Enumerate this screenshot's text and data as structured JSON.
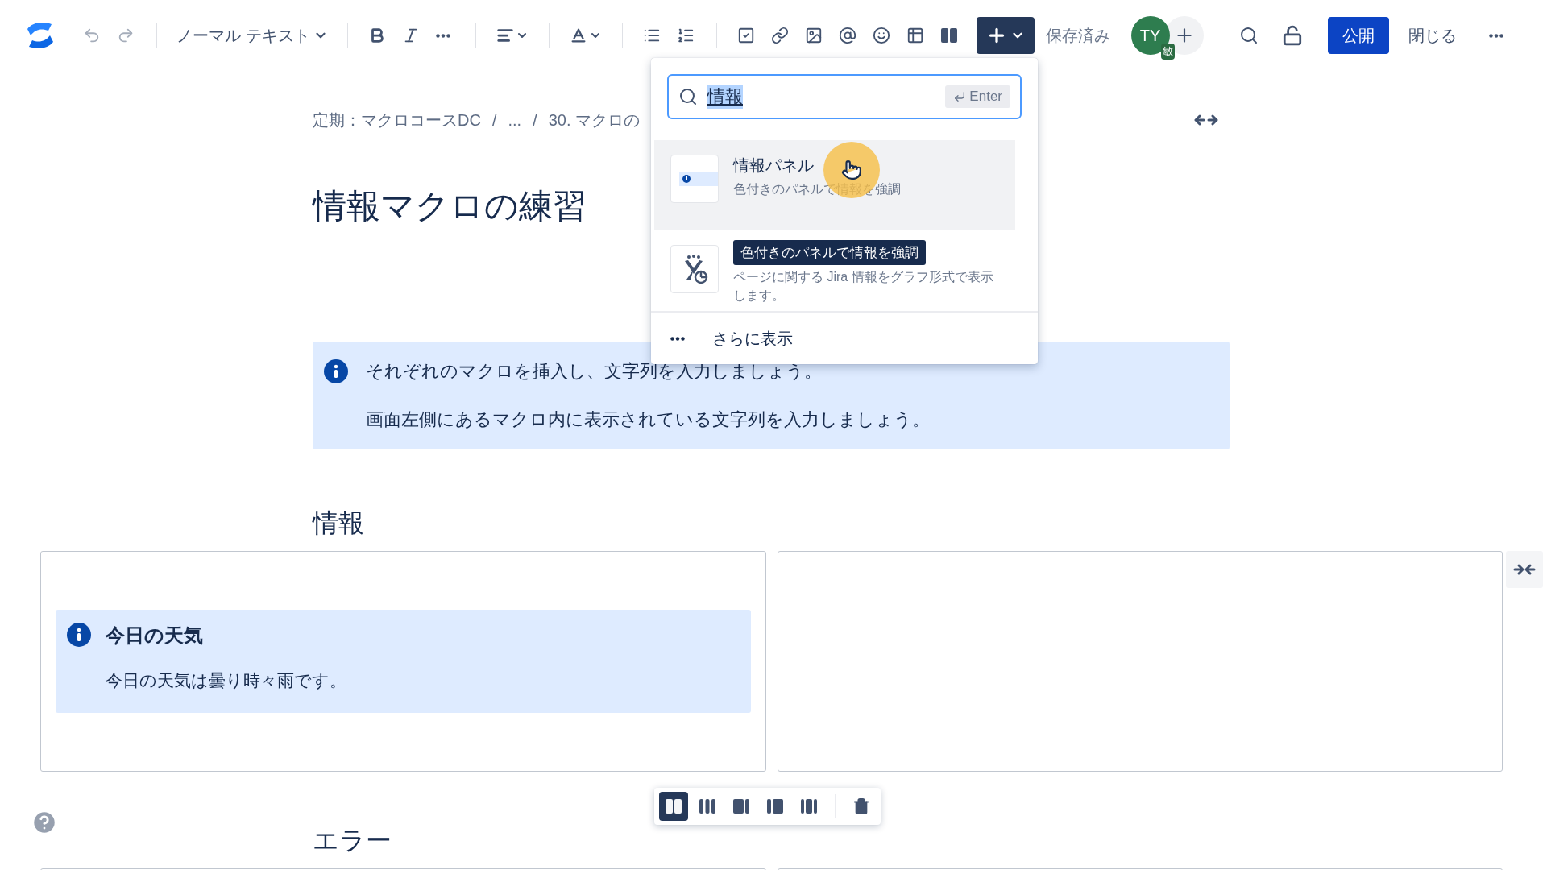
{
  "toolbar": {
    "items": [
      {
        "kind": "undo",
        "disabled": true
      },
      {
        "kind": "redo",
        "disabled": true
      },
      {
        "kind": "divider"
      },
      {
        "kind": "text_style",
        "label": "ノーマル テキスト"
      },
      {
        "kind": "divider"
      },
      {
        "kind": "bold"
      },
      {
        "kind": "italic"
      },
      {
        "kind": "more"
      },
      {
        "kind": "divider"
      },
      {
        "kind": "align"
      },
      {
        "kind": "divider"
      },
      {
        "kind": "text_color"
      },
      {
        "kind": "divider"
      },
      {
        "kind": "bullet_list"
      },
      {
        "kind": "numbered_list"
      },
      {
        "kind": "divider"
      },
      {
        "kind": "task"
      },
      {
        "kind": "link"
      },
      {
        "kind": "image"
      },
      {
        "kind": "mention"
      },
      {
        "kind": "emoji"
      },
      {
        "kind": "table"
      },
      {
        "kind": "layout"
      },
      {
        "kind": "insert",
        "expanded": true
      }
    ],
    "status": "保存済み",
    "avatar": {
      "initials": "TY",
      "badge": "敏"
    },
    "publish": "公開",
    "close": "閉じる"
  },
  "insert_menu": {
    "search": {
      "value": "情報",
      "hint": "Enter"
    },
    "items": [
      {
        "kind": "info",
        "title": "情報パネル",
        "description": "色付きのパネルで情報を強調",
        "selected": true
      },
      {
        "kind": "jira",
        "description": "ページに関する Jira 情報をグラフ形式で表示します。",
        "selected": false
      }
    ],
    "more": "さらに表示",
    "tooltip": "色付きのパネルで情報を強調"
  },
  "breadcrumb": {
    "separator": "/",
    "items": [
      "定期：マクロコースDC",
      "...",
      "30. マクロの"
    ]
  },
  "title": "情報マクロの練習",
  "info_panel": {
    "lines": [
      "それぞれのマクロを挿入し、文字列を入力しましょう。",
      "画面左側にあるマクロ内に表示されている文字列を入力しましょう。"
    ]
  },
  "sections": [
    {
      "heading": "情報",
      "columns": [
        {
          "panel": {
            "title": "今日の天気",
            "body": "今日の天気は曇り時々雨です。"
          }
        },
        {}
      ]
    },
    {
      "heading": "エラー",
      "columns": [
        {},
        {}
      ]
    }
  ],
  "layout_toolbar": {
    "options": [
      {
        "kind": "two",
        "selected": true
      },
      {
        "kind": "three",
        "selected": false
      },
      {
        "kind": "right_sidebar",
        "selected": false
      },
      {
        "kind": "left_sidebar",
        "selected": false
      },
      {
        "kind": "three_sidebars",
        "selected": false
      }
    ]
  }
}
